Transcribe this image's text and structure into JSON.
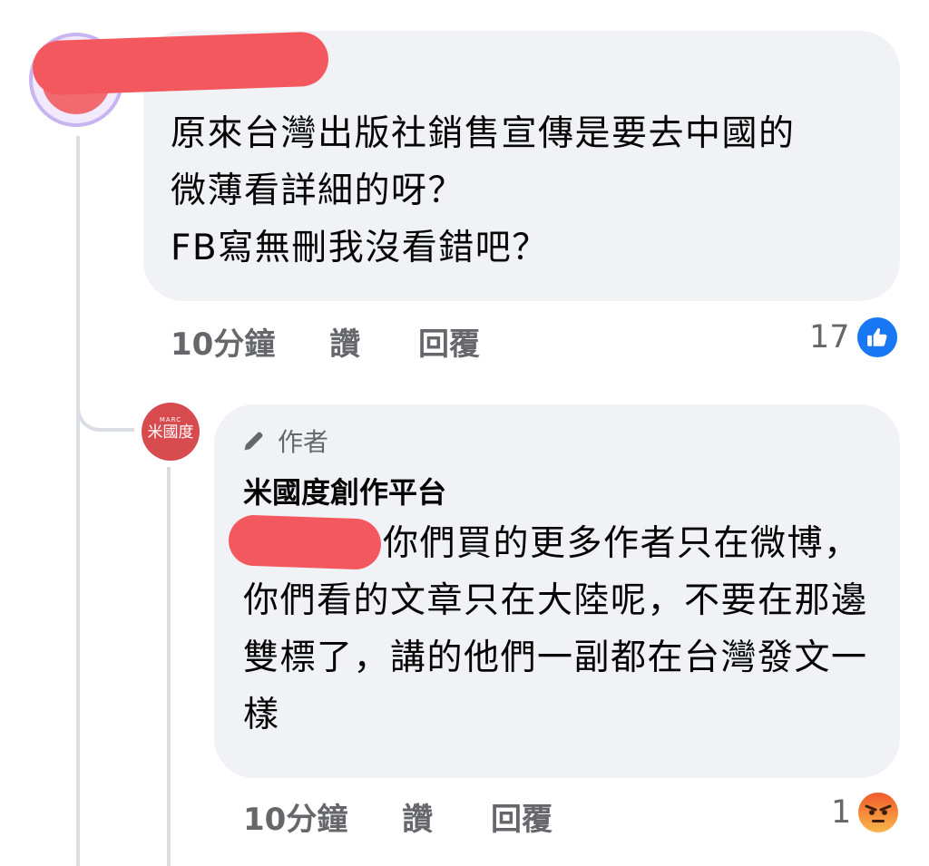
{
  "comment_1": {
    "text": "原來台灣出版社銷售宣傳是要去中國的\n微薄看詳細的呀？\nFB寫無刪我沒看錯吧？",
    "time": "10分鐘",
    "like_label": "讚",
    "reply_label": "回覆",
    "reaction_count": "17",
    "reaction_icon": "like-icon"
  },
  "comment_2": {
    "badge": "作者",
    "author": "米國度創作平台",
    "avatar_text_small": "MARC",
    "avatar_text": "米國度",
    "text": "你們買的更多作者只在微博，你們看的文章只在大陸呢，不要在那邊雙標了，講的他們一副都在台灣發文一樣",
    "time": "10分鐘",
    "like_label": "讚",
    "reply_label": "回覆",
    "reaction_count": "1",
    "reaction_icon": "angry-icon"
  },
  "colors": {
    "bubble": "#f0f2f5",
    "secondary_text": "#65676b",
    "like_blue": "#1877f2",
    "redaction": "#f2585d",
    "author_avatar": "#d74b4f"
  }
}
